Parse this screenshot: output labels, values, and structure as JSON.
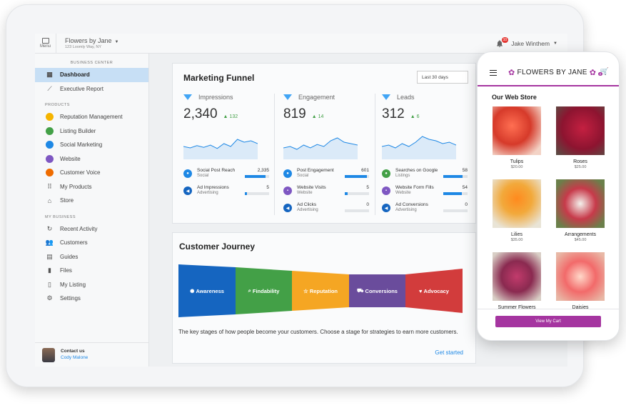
{
  "topbar": {
    "menu_label": "Menu",
    "business_name": "Flowers by Jane",
    "business_address": "123 Loomly Way, NY",
    "notification_count": "10",
    "user_name": "Jake Winthem"
  },
  "sidebar": {
    "section_business_center": "BUSINESS CENTER",
    "top_items": [
      {
        "label": "Dashboard",
        "icon": "dashboard-icon",
        "active": true
      },
      {
        "label": "Executive Report",
        "icon": "trend-icon"
      }
    ],
    "section_products": "PRODUCTS",
    "products": [
      {
        "label": "Reputation Management",
        "icon": "star-icon",
        "color": "#f5b400"
      },
      {
        "label": "Listing Builder",
        "icon": "pin-icon",
        "color": "#43a047"
      },
      {
        "label": "Social Marketing",
        "icon": "chat-icon",
        "color": "#1e88e5"
      },
      {
        "label": "Website",
        "icon": "website-icon",
        "color": "#7e57c2"
      },
      {
        "label": "Customer Voice",
        "icon": "voice-icon",
        "color": "#ef6c00"
      },
      {
        "label": "My Products",
        "icon": "grid-icon"
      },
      {
        "label": "Store",
        "icon": "basket-icon"
      }
    ],
    "section_my_business": "MY BUSINESS",
    "business": [
      {
        "label": "Recent Activity",
        "icon": "refresh-icon"
      },
      {
        "label": "Customers",
        "icon": "people-icon"
      },
      {
        "label": "Guides",
        "icon": "guide-icon"
      },
      {
        "label": "Files",
        "icon": "files-icon"
      },
      {
        "label": "My Listing",
        "icon": "phone-icon"
      },
      {
        "label": "Settings",
        "icon": "gear-icon"
      }
    ],
    "contact_label": "Contact us",
    "contact_person": "Cody Malone"
  },
  "marketing_funnel": {
    "title": "Marketing Funnel",
    "range": "Last 30 days",
    "columns": [
      {
        "label": "Impressions",
        "value": "2,340",
        "delta": "132",
        "trend": [
          0.55,
          0.6,
          0.52,
          0.58,
          0.5,
          0.62,
          0.45,
          0.55,
          0.3,
          0.4,
          0.35,
          0.45
        ],
        "metrics": [
          {
            "name": "Social Post Reach",
            "sub": "Social",
            "value": "2,335",
            "level": 0.85,
            "color": "#1e88e5"
          },
          {
            "name": "Ad Impressions",
            "sub": "Advertising",
            "value": "5",
            "level": 0.1,
            "color": "#1565c0"
          }
        ]
      },
      {
        "label": "Engagement",
        "value": "819",
        "delta": "14",
        "trend": [
          0.6,
          0.55,
          0.65,
          0.5,
          0.6,
          0.48,
          0.55,
          0.35,
          0.25,
          0.4,
          0.45,
          0.5
        ],
        "metrics": [
          {
            "name": "Post Engagement",
            "sub": "Social",
            "value": "601",
            "level": 0.9,
            "color": "#1e88e5"
          },
          {
            "name": "Website Visits",
            "sub": "Website",
            "value": "5",
            "level": 0.12,
            "color": "#7e57c2"
          },
          {
            "name": "Ad Clicks",
            "sub": "Advertising",
            "value": "0",
            "level": 0.0,
            "color": "#1565c0"
          }
        ]
      },
      {
        "label": "Leads",
        "value": "312",
        "delta": "6",
        "trend": [
          0.55,
          0.5,
          0.6,
          0.45,
          0.55,
          0.4,
          0.2,
          0.3,
          0.35,
          0.45,
          0.4,
          0.5
        ],
        "metrics": [
          {
            "name": "Searches on Google",
            "sub": "Listings",
            "value": "58",
            "level": 0.8,
            "color": "#43a047"
          },
          {
            "name": "Website Form Fills",
            "sub": "Website",
            "value": "54",
            "level": 0.75,
            "color": "#7e57c2"
          },
          {
            "name": "Ad Conversions",
            "sub": "Advertising",
            "value": "0",
            "level": 0.0,
            "color": "#1565c0"
          }
        ]
      }
    ]
  },
  "customer_journey": {
    "title": "Customer Journey",
    "stages": [
      {
        "label": "Awareness",
        "icon": "bulb-icon",
        "color": "#1565c0"
      },
      {
        "label": "Findability",
        "icon": "find-icon",
        "color": "#43a047"
      },
      {
        "label": "Reputation",
        "icon": "star-icon",
        "color": "#f5a623"
      },
      {
        "label": "Conversions",
        "icon": "cart-icon",
        "color": "#6a4c9c"
      },
      {
        "label": "Advocacy",
        "icon": "heart-icon",
        "color": "#d23c3c"
      }
    ],
    "description": "The key stages of how people become your customers. Choose a stage for strategies to earn more customers.",
    "cta": "Get started"
  },
  "phone": {
    "logo": "FLOWERS BY JANE",
    "cart_count": "3",
    "store_title": "Our Web Store",
    "products": [
      {
        "name": "Tulips",
        "price": "$20.00"
      },
      {
        "name": "Roses",
        "price": "$25.00"
      },
      {
        "name": "Lilies",
        "price": "$35.00"
      },
      {
        "name": "Arrangements",
        "price": "$45.00"
      },
      {
        "name": "Summer Flowers",
        "price": ""
      },
      {
        "name": "Daisies",
        "price": ""
      }
    ],
    "cart_button": "View My Cart"
  }
}
